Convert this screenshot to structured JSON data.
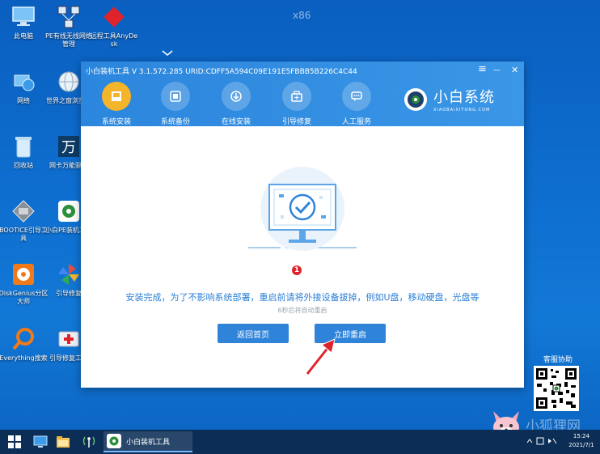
{
  "desktop": {
    "arch": "x86",
    "icons": [
      {
        "label": "此电脑"
      },
      {
        "label": "PE有线无线网络管理"
      },
      {
        "label": "远程工具AnyDesk"
      },
      {
        "label": "网络"
      },
      {
        "label": "世界之窗浏览器"
      },
      {
        "label": "回收站"
      },
      {
        "label": "网卡万能驱动"
      },
      {
        "label": "BOOTICE引导工具"
      },
      {
        "label": "小白PE装机工具"
      },
      {
        "label": "DiskGenius分区大师"
      },
      {
        "label": "引导修复"
      },
      {
        "label": "Everything搜索"
      },
      {
        "label": "引导修复工具"
      }
    ]
  },
  "window": {
    "title": "小白装机工具 V 3.1.572.285 URID:CDFF5A594C09E191E5FBBB5B226C4C44",
    "controls": {
      "menu": "≡",
      "minimize": "—",
      "close": "✕"
    },
    "nav": [
      {
        "label": "系统安装",
        "active": true
      },
      {
        "label": "系统备份",
        "active": false
      },
      {
        "label": "在线安装",
        "active": false
      },
      {
        "label": "引导修复",
        "active": false
      },
      {
        "label": "人工服务",
        "active": false
      }
    ],
    "brand": {
      "name": "小白系统",
      "sub": "XIAOBAIXITONG.COM"
    },
    "message": "安装完成，为了不影响系统部署，重启前请将外接设备拔掉，例如U盘，移动硬盘，光盘等",
    "countdown": "6秒后将自动重启",
    "buttons": {
      "back": "返回首页",
      "restart": "立即重启"
    },
    "badge": "1"
  },
  "side": {
    "customer_service": "客服协助",
    "watermark": "小狐狸网"
  },
  "taskbar": {
    "app_label": "小白装机工具",
    "clock_time": "15:24",
    "clock_date": "2021/7/1"
  },
  "colors": {
    "accent": "#2f84da",
    "header": "#2b86dd",
    "active_nav": "#f5b52a",
    "badge": "#e0232b",
    "message": "#2a7fd6"
  }
}
